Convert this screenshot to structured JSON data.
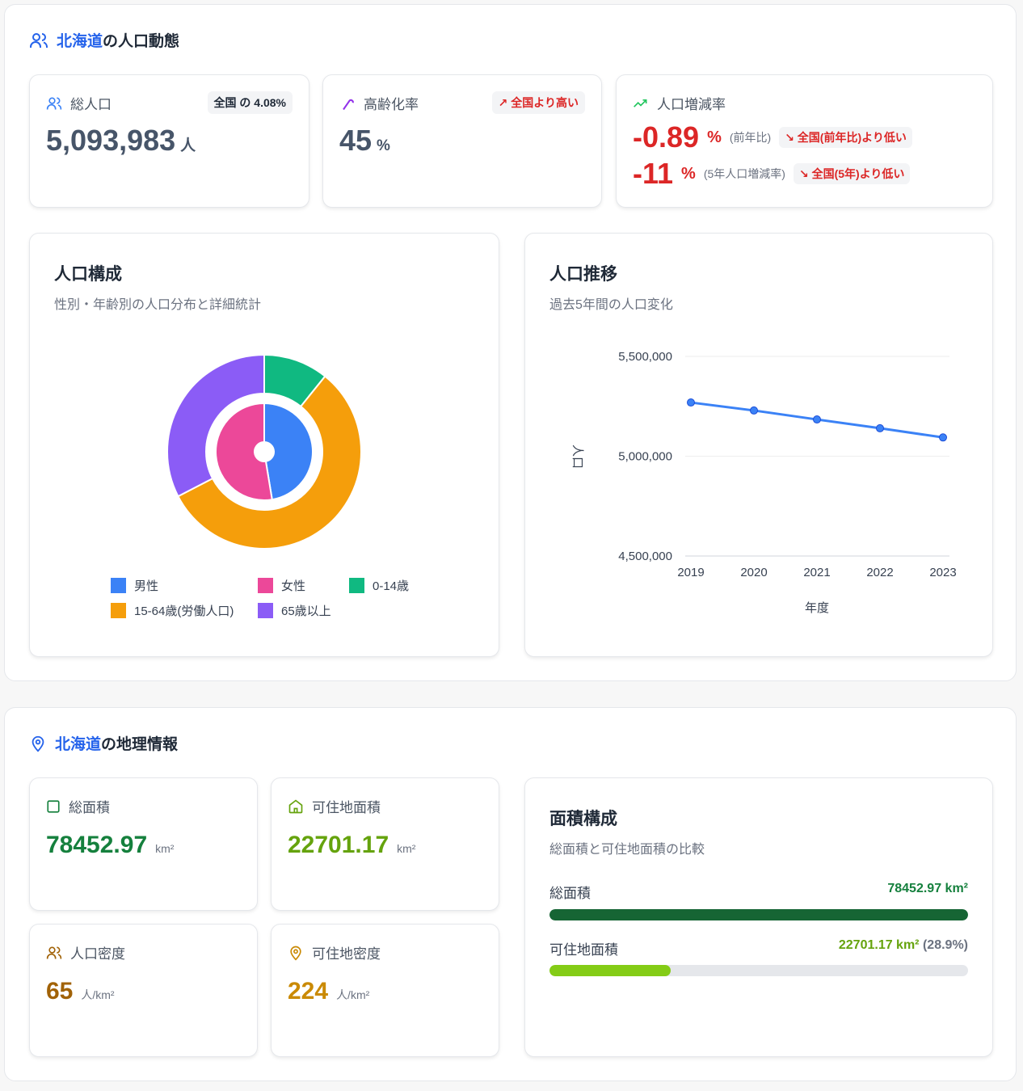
{
  "population": {
    "title_region": "北海道",
    "title_rest": "の人口動態",
    "total": {
      "label": "総人口",
      "value": "5,093,983",
      "unit": "人",
      "badge": "全国 の 4.08%"
    },
    "aging": {
      "label": "高齢化率",
      "value": "45",
      "unit": "%",
      "badge": "↗ 全国より高い"
    },
    "change": {
      "label": "人口増減率",
      "yoy_value": "-0.89",
      "yoy_unit": "%",
      "yoy_sub": "(前年比)",
      "yoy_badge": "↘ 全国(前年比)より低い",
      "five_value": "-11",
      "five_unit": "%",
      "five_sub": "(5年人口増減率)",
      "five_badge": "↘ 全国(5年)より低い"
    },
    "composition": {
      "title": "人口構成",
      "subtitle": "性別・年齢別の人口分布と詳細統計",
      "legend": [
        {
          "label": "男性",
          "color": "#3b82f6"
        },
        {
          "label": "女性",
          "color": "#ec4899"
        },
        {
          "label": "0-14歳",
          "color": "#10b981"
        },
        {
          "label": "15-64歳(労働人口)",
          "color": "#f59e0b"
        },
        {
          "label": "65歳以上",
          "color": "#8b5cf6"
        }
      ]
    },
    "trend": {
      "title": "人口推移",
      "subtitle": "過去5年間の人口変化"
    }
  },
  "chart_data": [
    {
      "type": "pie",
      "title": "人口構成",
      "inner": {
        "labels": [
          "男性",
          "女性"
        ],
        "values": [
          47.4,
          52.6
        ],
        "colors": [
          "#3b82f6",
          "#ec4899"
        ]
      },
      "outer": {
        "labels": [
          "0-14歳",
          "15-64歳(労働人口)",
          "65歳以上"
        ],
        "values": [
          10.8,
          56.6,
          32.6
        ],
        "colors": [
          "#10b981",
          "#f59e0b",
          "#8b5cf6"
        ]
      }
    },
    {
      "type": "line",
      "title": "人口推移",
      "xlabel": "年度",
      "ylabel": "人口",
      "x": [
        "2019",
        "2020",
        "2021",
        "2022",
        "2023"
      ],
      "values": [
        5269000,
        5229000,
        5184000,
        5140000,
        5093983
      ],
      "ylim": [
        4500000,
        5500000
      ],
      "yticks": [
        "4,500,000",
        "5,000,000",
        "5,500,000"
      ],
      "color": "#3b82f6",
      "grid": true
    }
  ],
  "geo": {
    "title_region": "北海道",
    "title_rest": "の地理情報",
    "total_area": {
      "label": "総面積",
      "value": "78452.97",
      "unit": "km²"
    },
    "habitable_area": {
      "label": "可住地面積",
      "value": "22701.17",
      "unit": "km²"
    },
    "pop_density": {
      "label": "人口密度",
      "value": "65",
      "unit": "人/km²"
    },
    "habitable_density": {
      "label": "可住地密度",
      "value": "224",
      "unit": "人/km²"
    },
    "area_comp": {
      "title": "面積構成",
      "subtitle": "総面積と可住地面積の比較",
      "total_label": "総面積",
      "total_value": "78452.97 km²",
      "total_pct": 100,
      "hab_label": "可住地面積",
      "hab_value": "22701.17 km²",
      "hab_pct_text": "(28.9%)",
      "hab_pct": 28.9
    }
  }
}
